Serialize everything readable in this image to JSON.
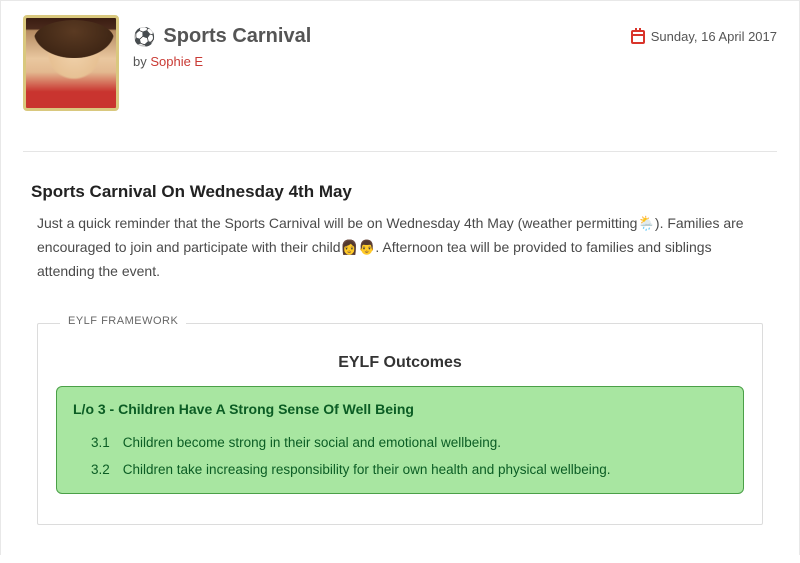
{
  "header": {
    "icon": "⚽",
    "title": "Sports Carnival",
    "date": "Sunday, 16 April 2017",
    "by_prefix": "by ",
    "author": "Sophie E"
  },
  "content": {
    "heading": "Sports Carnival On Wednesday 4th May",
    "paragraph": "Just a quick reminder that the Sports Carnival will be on Wednesday 4th May (weather permitting🌦️). Families are encouraged to join and participate with their child👩👨. Afternoon tea will be provided to families and siblings attending the event."
  },
  "framework": {
    "legend": "EYLF FRAMEWORK",
    "title": "EYLF Outcomes",
    "outcome": {
      "heading": "L/o 3 - Children Have A Strong Sense Of Well Being",
      "items": [
        {
          "num": "3.1",
          "text": "Children become strong in their social and emotional wellbeing."
        },
        {
          "num": "3.2",
          "text": "Children take increasing responsibility for their own health and physical wellbeing."
        }
      ]
    }
  }
}
